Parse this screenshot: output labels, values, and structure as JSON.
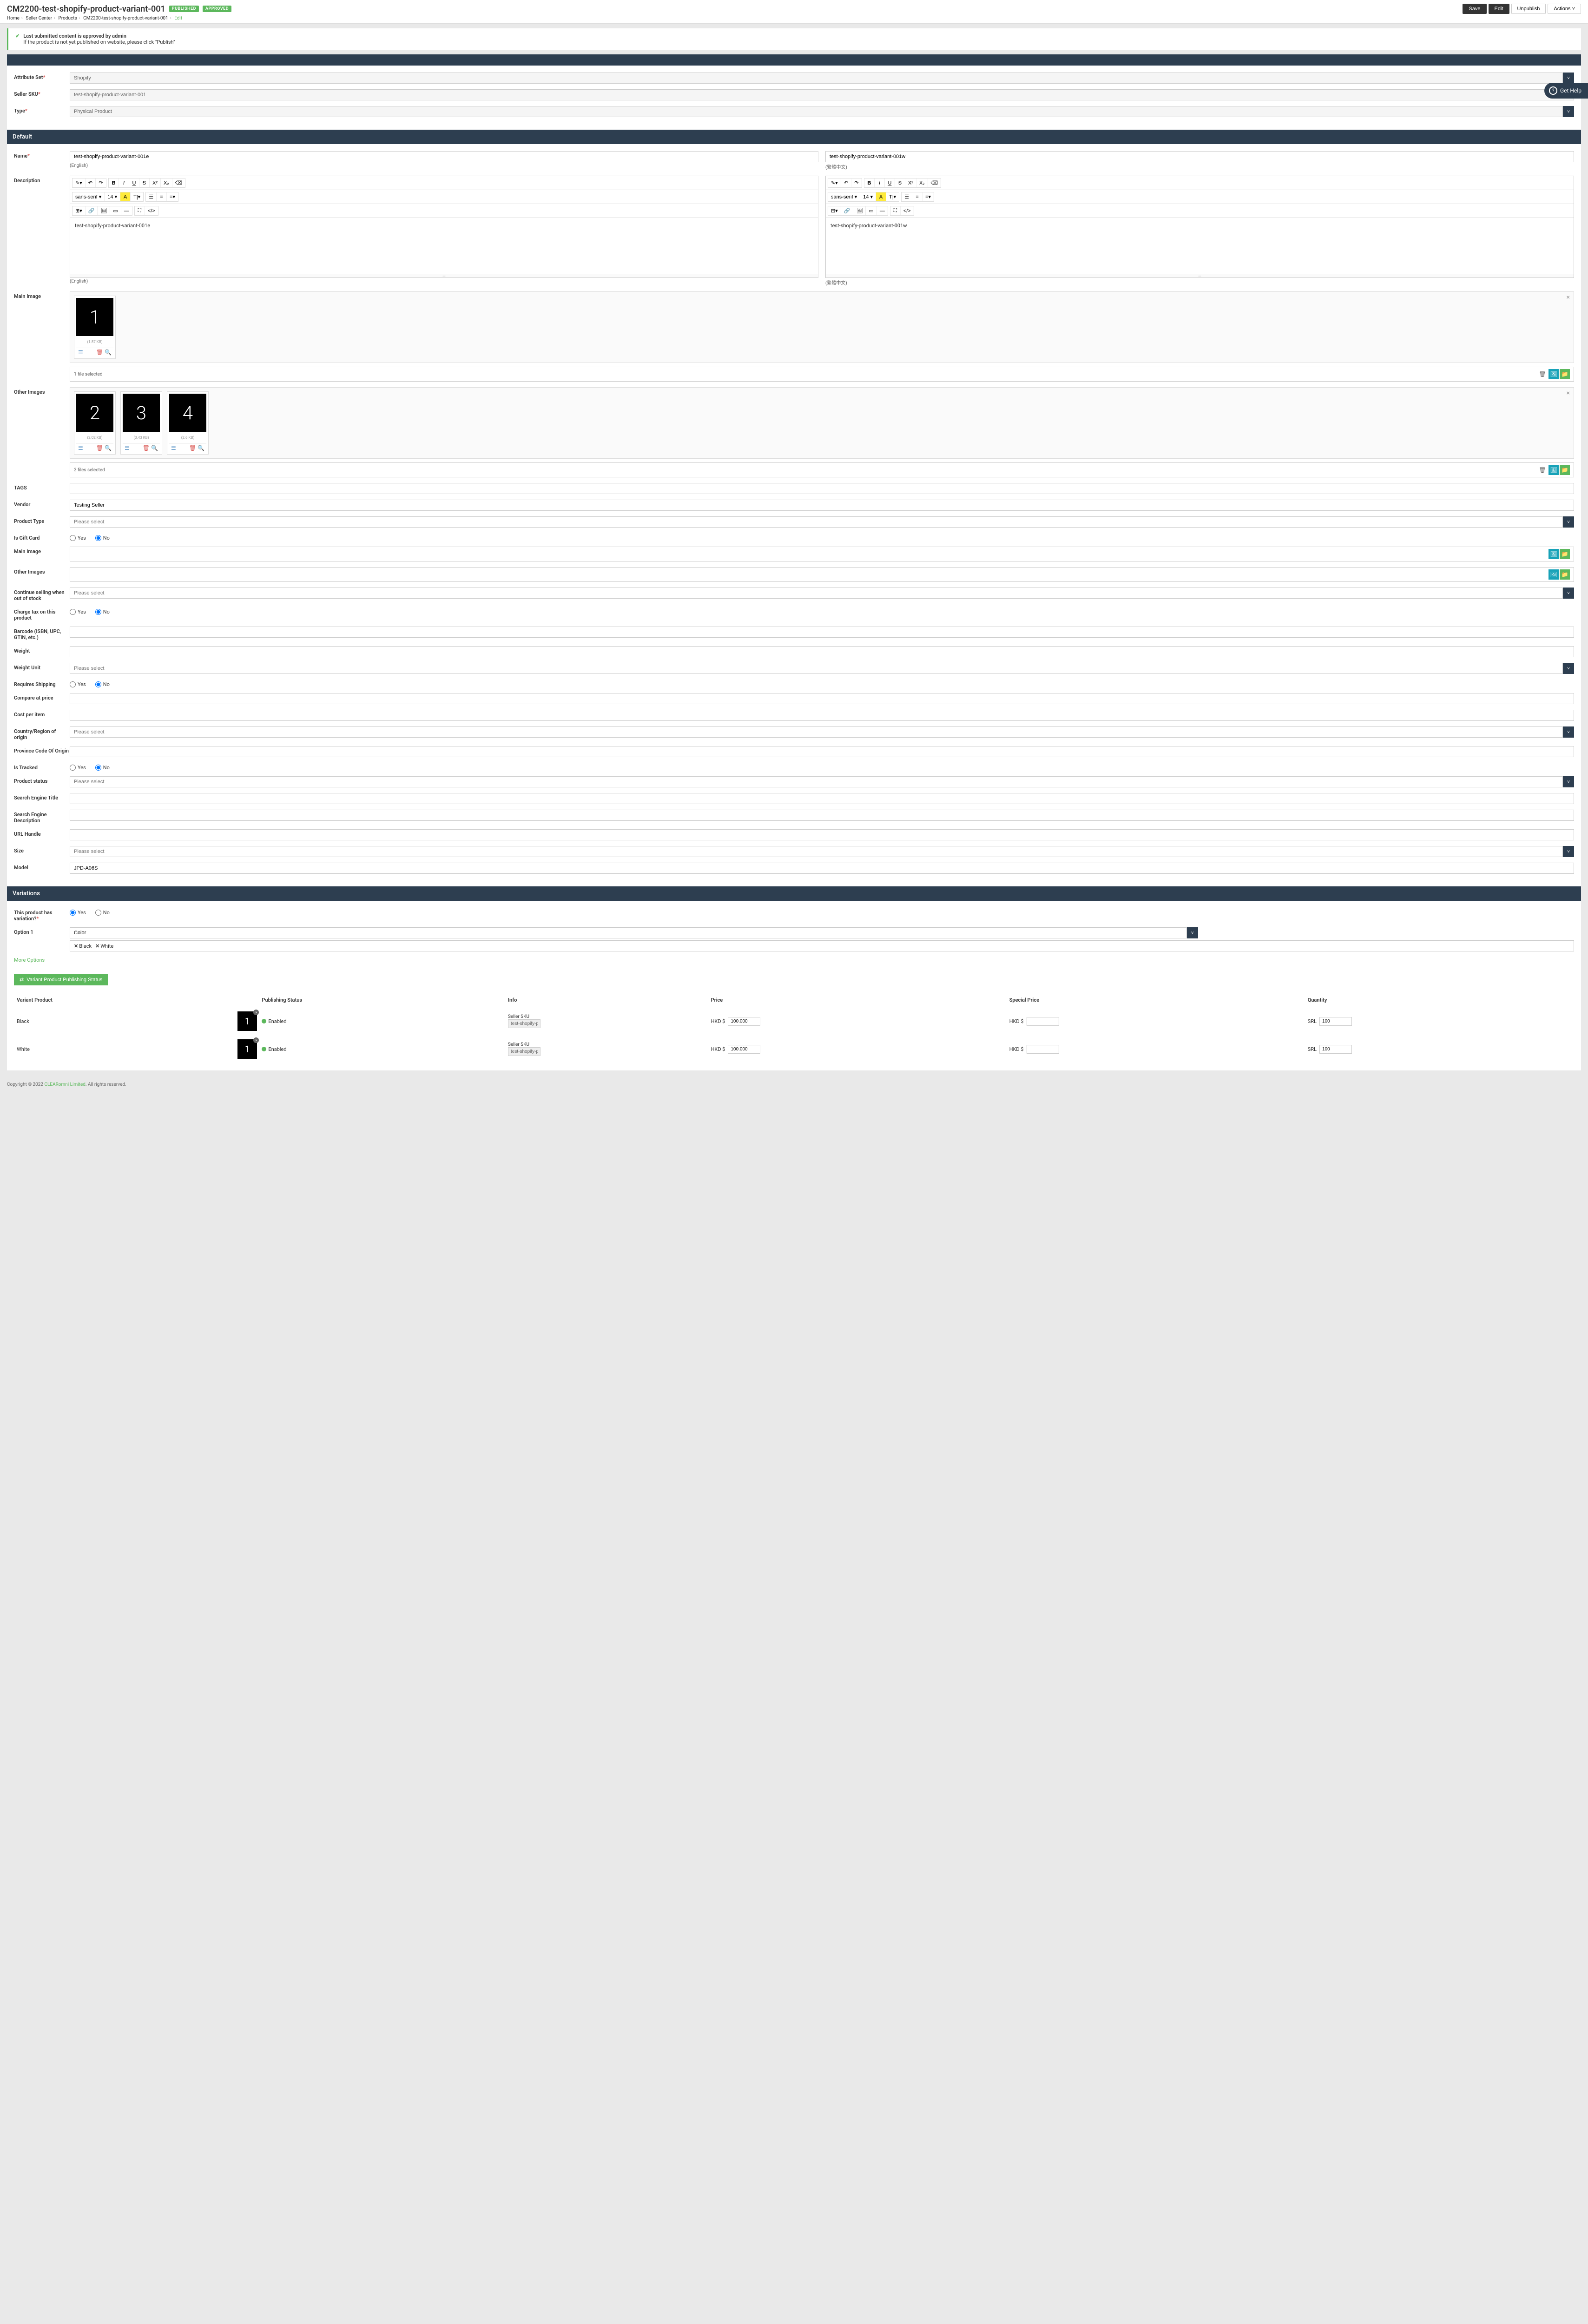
{
  "header": {
    "title": "CM2200-test-shopify-product-variant-001",
    "badge_published": "PUBLISHED",
    "badge_approved": "APPROVED",
    "save": "Save",
    "edit": "Edit",
    "unpublish": "Unpublish",
    "actions": "Actions"
  },
  "breadcrumb": {
    "home": "Home",
    "seller_center": "Seller Center",
    "products": "Products",
    "product": "CM2200-test-shopify-product-variant-001",
    "current": "Edit"
  },
  "notice": {
    "line1": "Last submitted content is approved by admin",
    "line2": "If the product is not yet published on website, please click \"Publish\""
  },
  "top_form": {
    "attribute_set_label": "Attribute Set",
    "attribute_set_value": "Shopify",
    "seller_sku_label": "Seller SKU",
    "seller_sku_value": "test-shopify-product-variant-001",
    "type_label": "Type",
    "type_value": "Physical Product"
  },
  "default_section": {
    "title": "Default",
    "name_label": "Name",
    "name_en": "test-shopify-product-variant-001e",
    "name_zh": "test-shopify-product-variant-001w",
    "lang_en": "(English)",
    "lang_zh": "(繁體中文)",
    "description_label": "Description",
    "desc_en": "test-shopify-product-variant-001e",
    "desc_zh": "test-shopify-product-variant-001w",
    "main_image_label": "Main Image",
    "main_image": {
      "num": "1",
      "size": "(1.87 KB)"
    },
    "main_image_status": "1 file selected",
    "other_images_label": "Other Images",
    "other_images": [
      {
        "num": "2",
        "size": "(2.02 KB)"
      },
      {
        "num": "3",
        "size": "(3.43 KB)"
      },
      {
        "num": "4",
        "size": "(2.6 KB)"
      }
    ],
    "other_images_status": "3 files selected",
    "tags_label": "TAGS",
    "vendor_label": "Vendor",
    "vendor_value": "Testing Seller",
    "product_type_label": "Product Type",
    "please_select": "Please select",
    "gift_card_label": "Is Gift Card",
    "yes": "Yes",
    "no": "No",
    "main_image2_label": "Main Image",
    "other_images2_label": "Other Images",
    "continue_selling_label": "Continue selling when out of stock",
    "charge_tax_label": "Charge tax on this product",
    "barcode_label": "Barcode (ISBN, UPC, GTIN, etc.)",
    "weight_label": "Weight",
    "weight_unit_label": "Weight Unit",
    "requires_shipping_label": "Requires Shipping",
    "compare_price_label": "Compare at price",
    "cost_per_item_label": "Cost per item",
    "country_origin_label": "Country/Region of origin",
    "province_origin_label": "Province Code Of Origin",
    "is_tracked_label": "Is Tracked",
    "product_status_label": "Product status",
    "seo_title_label": "Search Engine Title",
    "seo_desc_label": "Search Engine Description",
    "url_handle_label": "URL Handle",
    "size_label": "Size",
    "model_label": "Model",
    "model_value": "JPD-A06S"
  },
  "editor_toolbar": {
    "font_family": "sans-serif",
    "font_size": "14"
  },
  "variations": {
    "title": "Variations",
    "has_variation_label": "This product has variation?",
    "option1_label": "Option 1",
    "option1_value": "Color",
    "chip_black": "Black",
    "chip_white": "White",
    "more_options": "More Options",
    "status_btn": "Variant Product Publishing Status",
    "headers": {
      "variant_product": "Variant Product",
      "publishing_status": "Publishing Status",
      "info": "Info",
      "price": "Price",
      "special_price": "Special Price",
      "quantity": "Quantity"
    },
    "seller_sku_label": "Seller SKU",
    "enabled": "Enabled",
    "currency": "HKD $",
    "srl": "SRL",
    "rows": [
      {
        "name": "Black",
        "thumb": "1",
        "sku": "test-shopify-proc",
        "price": "100.000",
        "qty": "100"
      },
      {
        "name": "White",
        "thumb": "1",
        "sku": "test-shopify-proc",
        "price": "100.000",
        "qty": "100"
      }
    ]
  },
  "get_help": "Get Help",
  "footer": {
    "copyright": "Copyright © 2022 ",
    "company": "CLEARomni Limited",
    "rights": ". All rights reserved."
  }
}
